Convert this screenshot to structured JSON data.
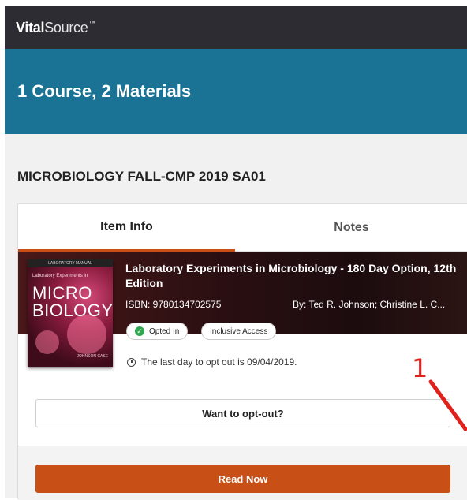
{
  "header": {
    "logo_bold": "Vital",
    "logo_light": "Source",
    "logo_tm": "™"
  },
  "banner": {
    "title": "1 Course,  2 Materials"
  },
  "course": {
    "title": "MICROBIOLOGY FALL-CMP 2019 SA01"
  },
  "tabs": [
    {
      "label": "Item Info",
      "active": true
    },
    {
      "label": "Notes",
      "active": false
    }
  ],
  "book": {
    "title": "Laboratory Experiments in Microbiology - 180 Day Option, 12th Edition",
    "isbn": "ISBN: 9780134702575",
    "authors": "By: Ted R. Johnson; Christine L. C...",
    "cover": {
      "top_label": "LABORATORY MANUAL",
      "subtitle": "Laboratory Experiments in",
      "title_line1": "MICRO",
      "title_line2": "BIOLOGY",
      "authors": "JOHNSON CASE"
    },
    "badges": [
      {
        "label": "Opted In",
        "icon": "check-circle-icon",
        "color": "#2fa84f"
      },
      {
        "label": "Inclusive Access"
      }
    ],
    "deadline_text": "The last day to opt out is 09/04/2019."
  },
  "actions": {
    "optout_label": "Want to opt-out?",
    "read_label": "Read Now"
  },
  "annotation": {
    "number": "1",
    "color": "#e0201a"
  },
  "colors": {
    "topbar": "#2e2c33",
    "banner": "#1a7394",
    "accent": "#c84f16"
  }
}
